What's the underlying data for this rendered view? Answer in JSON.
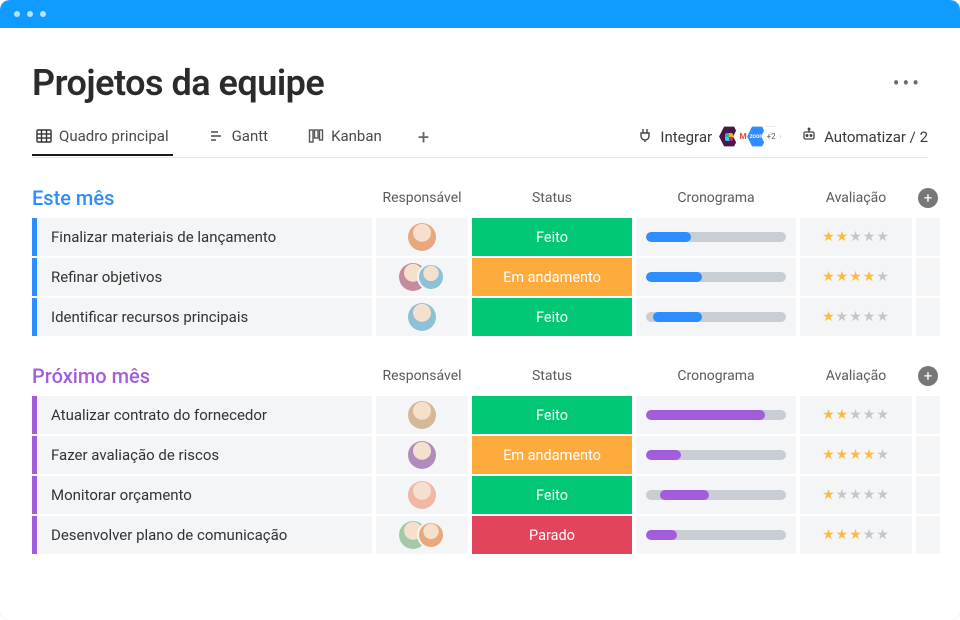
{
  "page": {
    "title": "Projetos da equipe"
  },
  "tabs": {
    "main": "Quadro principal",
    "gantt": "Gantt",
    "kanban": "Kanban"
  },
  "actions": {
    "integrate": "Integrar",
    "integrate_more": "+2",
    "automate": "Automatizar / 2"
  },
  "columns": {
    "owner": "Responsável",
    "status": "Status",
    "timeline": "Cronograma",
    "rating": "Avaliação"
  },
  "status_labels": {
    "done": "Feito",
    "working": "Em andamento",
    "stuck": "Parado"
  },
  "groups": [
    {
      "title": "Este mês",
      "color": "blue",
      "rows": [
        {
          "task": "Finalizar materiais de lançamento",
          "owners": 1,
          "status": "done",
          "tl_start": 0,
          "tl_width": 32,
          "rating": 2
        },
        {
          "task": "Refinar objetivos",
          "owners": 2,
          "status": "working",
          "tl_start": 0,
          "tl_width": 40,
          "rating": 4
        },
        {
          "task": "Identificar recursos principais",
          "owners": 1,
          "status": "done",
          "tl_start": 5,
          "tl_width": 35,
          "rating": 1
        }
      ]
    },
    {
      "title": "Próximo mês",
      "color": "purple",
      "rows": [
        {
          "task": "Atualizar contrato do fornecedor",
          "owners": 1,
          "status": "done",
          "tl_start": 0,
          "tl_width": 85,
          "rating": 2
        },
        {
          "task": "Fazer avaliação de riscos",
          "owners": 1,
          "status": "working",
          "tl_start": 0,
          "tl_width": 25,
          "rating": 4
        },
        {
          "task": "Monitorar orçamento",
          "owners": 1,
          "status": "done",
          "tl_start": 10,
          "tl_width": 35,
          "rating": 1
        },
        {
          "task": "Desenvolver plano de comunicação",
          "owners": 2,
          "status": "stuck",
          "tl_start": 0,
          "tl_width": 22,
          "rating": 3
        }
      ]
    }
  ],
  "avatar_colors": [
    "#e8a87c",
    "#c38d9e",
    "#8ec1d6",
    "#85cdca",
    "#d5b895",
    "#b08bbb",
    "#f0b7a4",
    "#a3c9a8"
  ]
}
